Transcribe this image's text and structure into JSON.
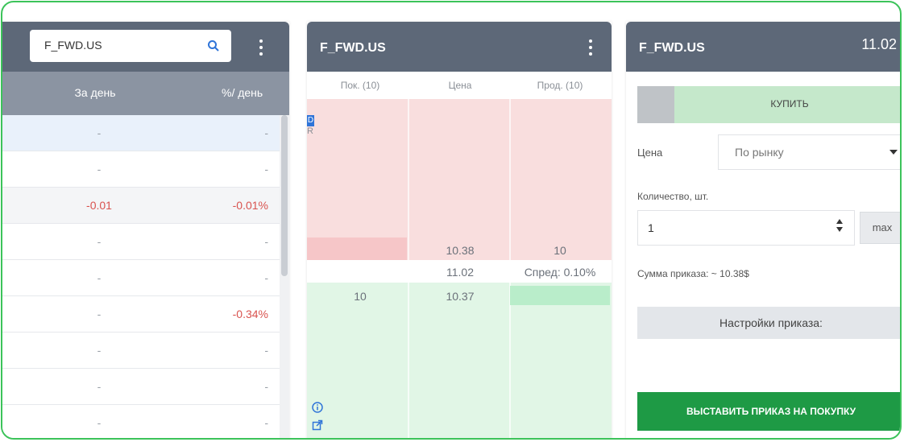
{
  "watchlist": {
    "search_value": "F_FWD.US",
    "columns": {
      "day_change": "За день",
      "day_change_pct": "%/ день"
    },
    "rows": [
      {
        "change": "-",
        "pct": "-",
        "selected": true
      },
      {
        "change": "-",
        "pct": "-"
      },
      {
        "change": "-0.01",
        "pct": "-0.01%",
        "alt": true
      },
      {
        "change": "-",
        "pct": "-"
      },
      {
        "change": "-",
        "pct": "-"
      },
      {
        "change": "-",
        "pct": "-0.34%"
      },
      {
        "change": "-",
        "pct": "-"
      },
      {
        "change": "-",
        "pct": "-"
      },
      {
        "change": "-",
        "pct": "-"
      }
    ]
  },
  "orderbook": {
    "title": "F_FWD.US",
    "col_buy": "Пок. (10)",
    "col_price": "Цена",
    "col_sell": "Прод. (10)",
    "marker_d": "D",
    "marker_r": "R",
    "ask": {
      "price": "10.38",
      "qty": "10"
    },
    "mid": {
      "price": "11.02",
      "spread": "Спред: 0.10%"
    },
    "bid": {
      "qty": "10",
      "price": "10.37"
    }
  },
  "order_form": {
    "title": "F_FWD.US",
    "last_price": "11.02",
    "side_buy_label": "КУПИТЬ",
    "price_label": "Цена",
    "price_type": "По рынку",
    "qty_label": "Количество, шт.",
    "qty_value": "1",
    "max_label": "max",
    "sum_label": "Сумма приказа: ~ 10.38$",
    "settings_label": "Настройки приказа:",
    "submit_label": "ВЫСТАВИТЬ ПРИКАЗ НА ПОКУПКУ"
  },
  "colors": {
    "accent_green": "#1e9a45",
    "header": "#5d6878",
    "frame": "#3cc35a"
  }
}
